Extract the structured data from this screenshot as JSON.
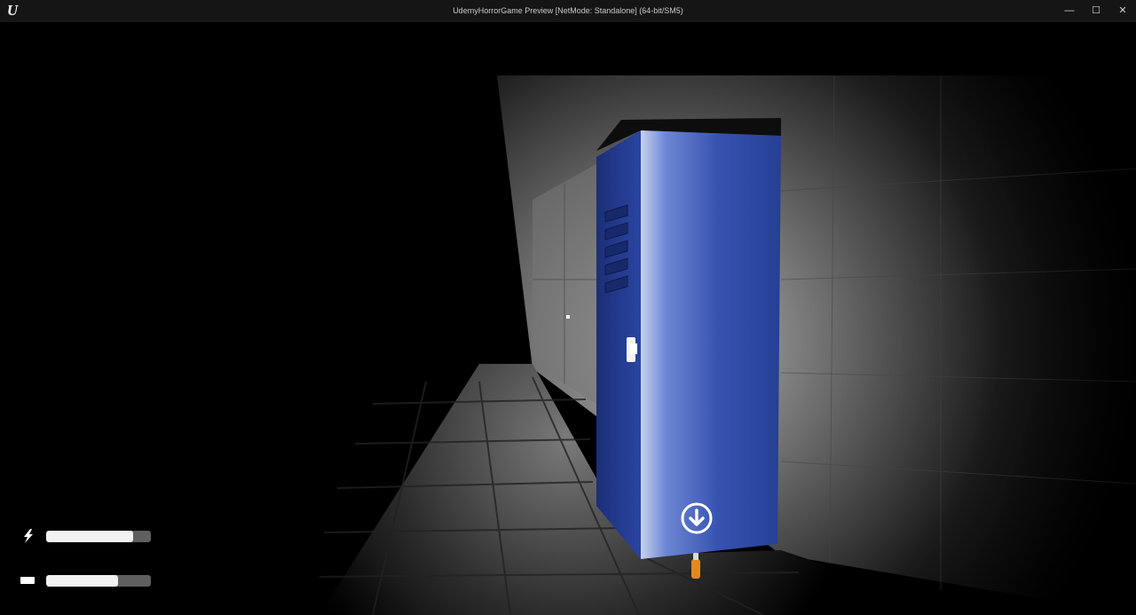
{
  "window": {
    "title": "UdemyHorrorGame Preview [NetMode: Standalone]  (64-bit/SM5)",
    "logo_icon": "unreal-engine-logo",
    "logo_glyph": "U",
    "min_glyph": "—",
    "max_glyph": "☐",
    "close_glyph": "✕"
  },
  "hud": {
    "energy": {
      "icon": "lightning-bolt-icon",
      "level": 0.83
    },
    "battery": {
      "icon": "battery-icon",
      "level": 0.69
    },
    "interact_icon": "down-arrow-circle-icon",
    "crosshair": "dot"
  },
  "colors": {
    "locker_blue": "#2c47a6",
    "bar_fill": "#f2f2f2",
    "bar_track": "#5f5f5f",
    "titlebar": "#151515",
    "battery_pickup": "#e08a1e"
  }
}
